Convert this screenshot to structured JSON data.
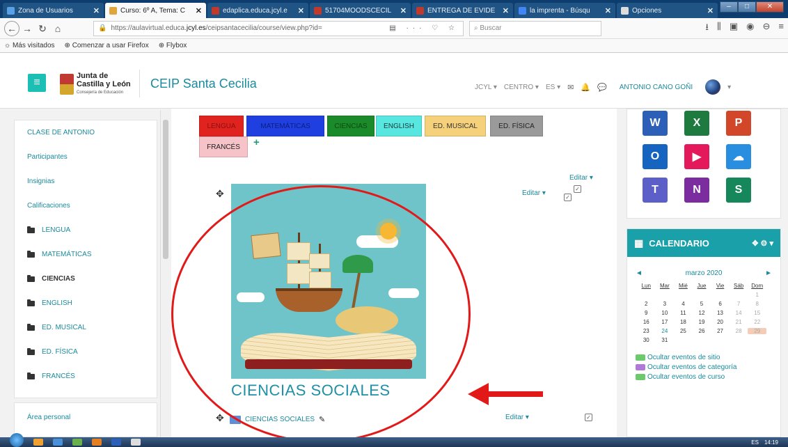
{
  "browser": {
    "tabs": [
      {
        "label": "Zona de Usuarios",
        "color": "#5aa0e6",
        "active": false
      },
      {
        "label": "Curso: 6º A, Tema: C",
        "color": "#e0a53c",
        "active": true
      },
      {
        "label": "edaplica.educa.jcyl.e",
        "color": "#c0392b",
        "active": false
      },
      {
        "label": "51704MOODSCECIL",
        "color": "#c0392b",
        "active": false
      },
      {
        "label": "ENTREGA DE EVIDE",
        "color": "#c0392b",
        "active": false
      },
      {
        "label": "la imprenta - Búsqu",
        "color": "#4285f4",
        "active": false
      },
      {
        "label": "Opciones",
        "color": "#dddddd",
        "active": false
      }
    ],
    "url_prefix": "https://aulavirtual.educa.",
    "url_domain": "jcyl.es",
    "url_path": "/ceipsantacecilia/course/view.php?id=",
    "search_placeholder": "Buscar",
    "bookmarks": [
      "Más visitados",
      "Comenzar a usar Firefox",
      "Flybox"
    ]
  },
  "header": {
    "logo_line1": "Junta de",
    "logo_line2": "Castilla y León",
    "logo_sub": "Consejería de Educación",
    "site_title": "CEIP Santa Cecilia",
    "nav": [
      "JCYL",
      "CENTRO",
      "ES"
    ],
    "user_name": "ANTONIO CANO GOÑI"
  },
  "sidebar": {
    "items": [
      {
        "label": "CLASE DE ANTONIO",
        "folder": false,
        "bold": false
      },
      {
        "label": "Participantes",
        "folder": false,
        "bold": false
      },
      {
        "label": "Insignias",
        "folder": false,
        "bold": false
      },
      {
        "label": "Calificaciones",
        "folder": false,
        "bold": false
      },
      {
        "label": "LENGUA",
        "folder": true,
        "bold": false
      },
      {
        "label": "MATEMÁTICAS",
        "folder": true,
        "bold": false
      },
      {
        "label": "CIENCIAS",
        "folder": true,
        "bold": true
      },
      {
        "label": "ENGLISH",
        "folder": true,
        "bold": false
      },
      {
        "label": "ED. MUSICAL",
        "folder": true,
        "bold": false
      },
      {
        "label": "ED. FÍSICA",
        "folder": true,
        "bold": false
      },
      {
        "label": "FRANCÉS",
        "folder": true,
        "bold": false
      }
    ],
    "area_personal": "Área personal"
  },
  "subjects": [
    {
      "label": "LENGUA",
      "color": "#e0231e",
      "text": "#8a1010"
    },
    {
      "label": "MATEMÁTICAS",
      "color": "#1f3fe0",
      "text": "#0d1f7a"
    },
    {
      "label": "CIENCIAS",
      "color": "#1b8a2a",
      "text": "#0a4a14"
    },
    {
      "label": "ENGLISH",
      "color": "#57e6e0",
      "text": "#1a3a3a"
    },
    {
      "label": "ED. MUSICAL",
      "color": "#f5d17c",
      "text": "#333333"
    },
    {
      "label": "ED. FÍSICA",
      "color": "#9a9a9a",
      "text": "#222222"
    },
    {
      "label": "FRANCÉS",
      "color": "#f6c4c8",
      "text": "#222222"
    }
  ],
  "main": {
    "edit_label": "Editar",
    "section_title": "CIENCIAS SOCIALES",
    "resource_label": "CIENCIAS SOCIALES"
  },
  "apps": [
    {
      "letter": "W",
      "color": "#2b5fb8"
    },
    {
      "letter": "X",
      "color": "#1e7a3e"
    },
    {
      "letter": "P",
      "color": "#d2472a"
    },
    {
      "letter": "O",
      "color": "#1565c0"
    },
    {
      "letter": "▶",
      "color": "#e3195b"
    },
    {
      "letter": "☁",
      "color": "#2a8ee0"
    },
    {
      "letter": "T",
      "color": "#5b5fc7"
    },
    {
      "letter": "N",
      "color": "#7b2c9e"
    },
    {
      "letter": "S",
      "color": "#16875a"
    }
  ],
  "calendar": {
    "title": "CALENDARIO",
    "month": "marzo 2020",
    "weekdays": [
      "Lun",
      "Mar",
      "Mié",
      "Jue",
      "Vie",
      "Sáb",
      "Dom"
    ],
    "leading_blanks": 6,
    "days": 31,
    "today": 29,
    "events": [
      "Ocultar eventos de sitio",
      "Ocultar eventos de categoría",
      "Ocultar eventos de curso"
    ]
  },
  "taskbar": {
    "lang": "ES",
    "time": "14:19"
  }
}
